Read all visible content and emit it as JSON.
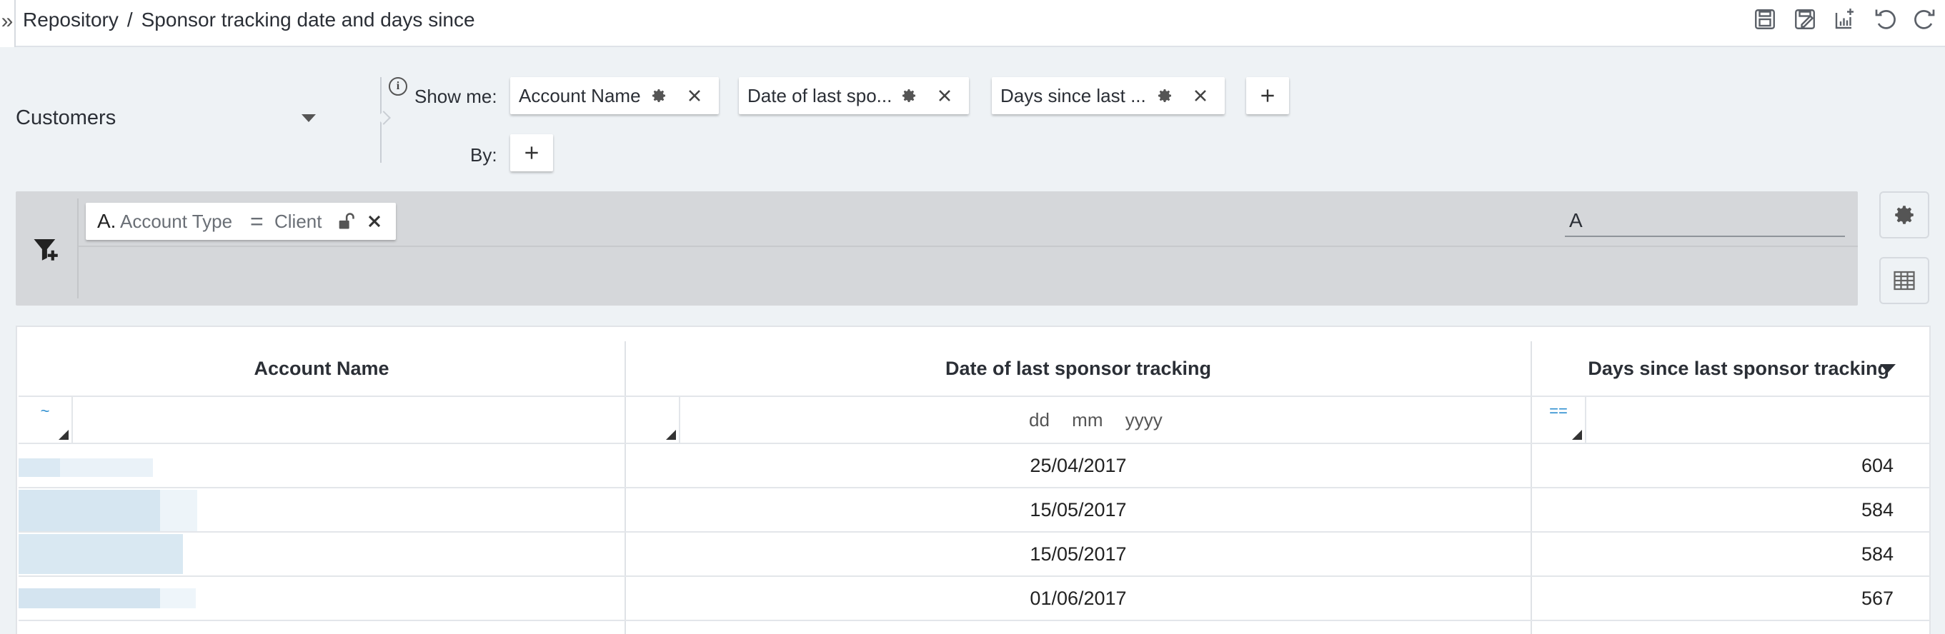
{
  "header": {
    "breadcrumb": [
      "Repository",
      "Sponsor tracking date and days since"
    ],
    "separator": "/",
    "toolbar": [
      {
        "icon": "save-icon"
      },
      {
        "icon": "save-as-icon"
      },
      {
        "icon": "add-chart-icon"
      },
      {
        "icon": "undo-icon"
      },
      {
        "icon": "redo-icon"
      }
    ]
  },
  "query": {
    "source": "Customers",
    "show_me_label": "Show me:",
    "by_label": "By:",
    "fields": [
      {
        "label": "Account Name"
      },
      {
        "label": "Date of last spo..."
      },
      {
        "label": "Days since last ..."
      }
    ]
  },
  "filters": {
    "chips": [
      {
        "letter": "A.",
        "field": "Account Type",
        "operator": "=",
        "value": "Client"
      }
    ],
    "logic": "A"
  },
  "table": {
    "columns": [
      {
        "label": "Account Name",
        "filter_operator": "~"
      },
      {
        "label": "Date of last sponsor tracking",
        "date_placeholder": [
          "dd",
          "mm",
          "yyyy"
        ]
      },
      {
        "label": "Days since last sponsor tracking",
        "filter_operator": "==",
        "sorted": "descending"
      }
    ],
    "rows": [
      {
        "account": "",
        "date": "25/04/2017",
        "days": "604"
      },
      {
        "account": "",
        "date": "15/05/2017",
        "days": "584"
      },
      {
        "account": "",
        "date": "15/05/2017",
        "days": "584"
      },
      {
        "account": "",
        "date": "01/06/2017",
        "days": "567"
      }
    ]
  },
  "colors": {
    "background": "#eef2f5",
    "filter_bar": "#d5d7da",
    "accent": "#2f8fd0"
  }
}
